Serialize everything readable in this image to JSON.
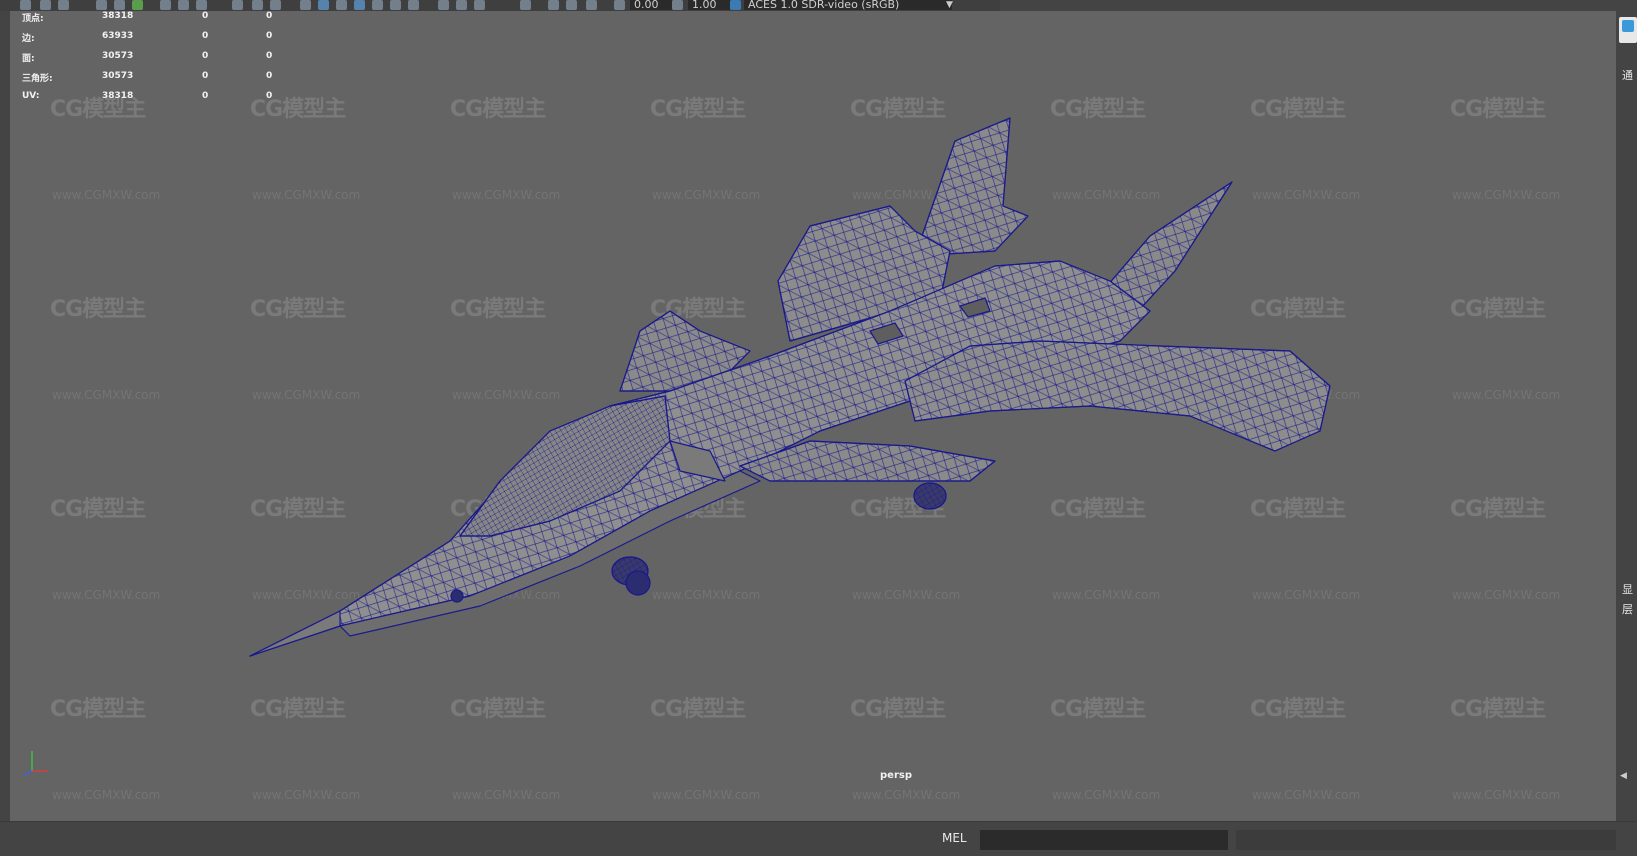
{
  "toolbar": {
    "exposure_value": "0.00",
    "gamma_value": "1.00",
    "color_space": "ACES 1.0 SDR-video (sRGB)"
  },
  "hud": {
    "rows": [
      {
        "label": "顶点:",
        "a": "38318",
        "b": "0",
        "c": "0"
      },
      {
        "label": "边:",
        "a": "63933",
        "b": "0",
        "c": "0"
      },
      {
        "label": "面:",
        "a": "30573",
        "b": "0",
        "c": "0"
      },
      {
        "label": "三角形:",
        "a": "30573",
        "b": "0",
        "c": "0"
      },
      {
        "label": "UV:",
        "a": "38318",
        "b": "0",
        "c": "0"
      }
    ]
  },
  "viewport": {
    "camera": "persp",
    "watermark_text": "CG模型主",
    "watermark_url": "www.CGMXW.com",
    "background_color": "#646464",
    "wireframe_color": "#1a1a8c",
    "surface_color": "#8e8e8e"
  },
  "axis_icon": "xyz-axis-icon",
  "right_panel": {
    "chars": [
      "通",
      "显",
      "层"
    ]
  },
  "command_line": {
    "language": "MEL",
    "value": ""
  }
}
